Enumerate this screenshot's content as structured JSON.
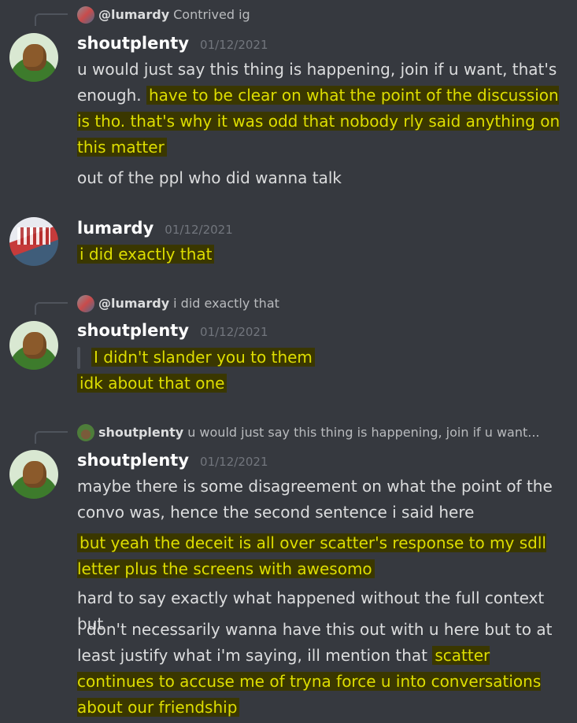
{
  "messages": [
    {
      "reply": {
        "name": "@lumardy",
        "text": "Contrived ig"
      },
      "author": "shoutplenty",
      "timestamp": "01/12/2021",
      "lines": {
        "p1_plain": "u would just say this thing is happening, join if u want, that's enough.",
        "p1_hl": "have to be clear on what the point of the discussion is tho. that's why it was odd that nobody rly said anything on this matter",
        "p2": "out of the ppl who did wanna talk"
      }
    },
    {
      "author": "lumardy",
      "timestamp": "01/12/2021",
      "lines": {
        "p1_hl": "i did exactly that"
      }
    },
    {
      "reply": {
        "name": "@lumardy",
        "text": "i did exactly that"
      },
      "author": "shoutplenty",
      "timestamp": "01/12/2021",
      "lines": {
        "quote_hl": "I didn't slander you to them",
        "p1_hl": "idk about that one"
      }
    },
    {
      "reply": {
        "name": "shoutplenty",
        "text": "u would just say this thing is happening, join if u want..."
      },
      "author": "shoutplenty",
      "timestamp": "01/12/2021",
      "lines": {
        "p1": "maybe there is some disagreement on what the point of the convo was, hence the second sentence i said here",
        "p2_hl": "but yeah the deceit is all over scatter's response to my sdll letter plus the screens with awesomo",
        "p3": "hard to say exactly what happened without the full context but",
        "p4_plain": "i don't necessarily wanna have this out with u here but to at least justify what i'm saying, ill mention that",
        "p4_hl": "scatter continues to accuse me of tryna force u into conversations about our friendship"
      }
    }
  ]
}
